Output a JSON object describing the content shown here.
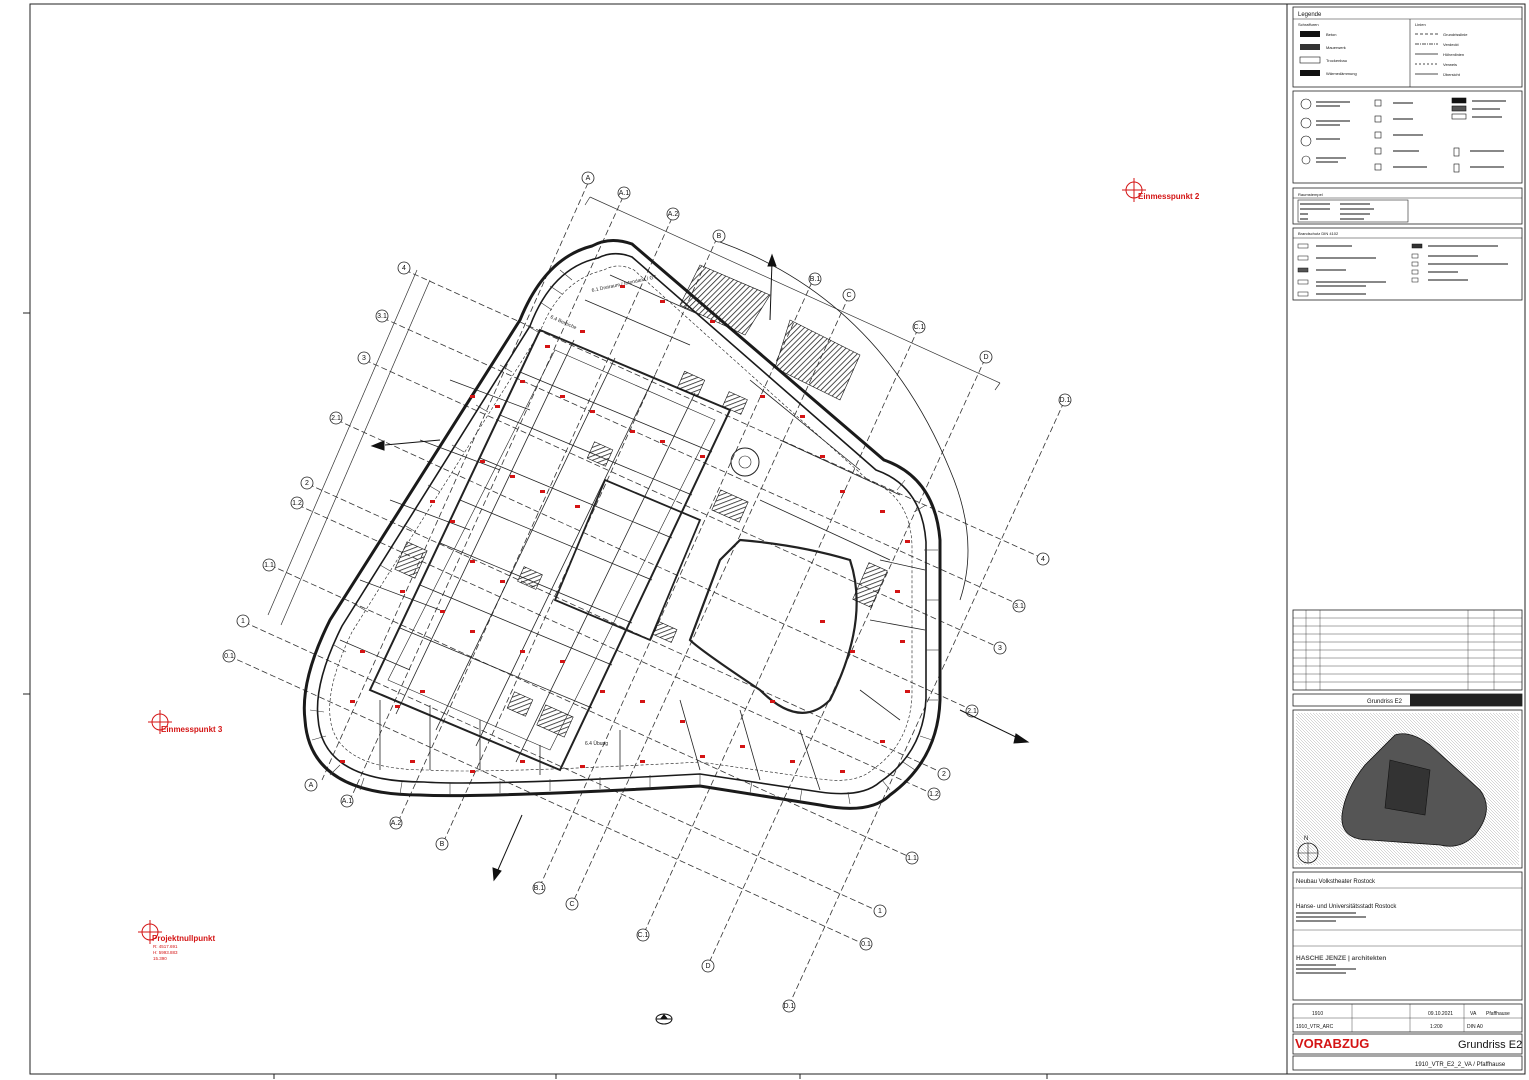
{
  "drawing": {
    "survey_points": [
      {
        "label": "Einmesspunkt 2"
      },
      {
        "label": "Einmesspunkt 3"
      },
      {
        "label": "Projektnullpunkt",
        "coords": [
          "R: 4517.691",
          "H: 5993.883",
          "15.390"
        ]
      }
    ],
    "grid_letters": [
      "A",
      "A.1",
      "A.2",
      "B",
      "B.1",
      "C",
      "C.1",
      "D",
      "D.1"
    ],
    "grid_numbers": [
      "4",
      "3.1",
      "3",
      "2.1",
      "2",
      "1.2",
      "1.1",
      "1",
      "0.1"
    ],
    "room_labels": [
      "6.1 Dreiraum / Intendanz / GT",
      "6.4 Bereiche",
      "6.4 Übung"
    ]
  },
  "title_block": {
    "legend_title": "Legende",
    "hatch_header": "Schraffuren",
    "line_header": "Linien",
    "hatch_items": [
      "Beton",
      "Mauerwerk",
      "Trockenbau",
      "Wärmedämmung"
    ],
    "line_items": [
      "Grundrisslinie",
      "Verdeckt",
      "Höhenlinien",
      "Verweis",
      "Übersicht"
    ],
    "room_stamp_title": "Raumstempel",
    "fire_title": "Brandschutz DIN 4102",
    "drawing_name": "Grundriss E2",
    "project": "Neubau Volkstheater Rostock",
    "client": "Hanse- und Universitätsstadt Rostock",
    "architect": "HASCHE JENZE | architekten",
    "project_no": "1910",
    "date": "09.10.2021",
    "phase": "VA",
    "author": "Pfaffhause",
    "file_code": "1910_VTR_ARC",
    "scale": "1:200",
    "sheet_format": "DIN A0",
    "status": "VORABZUG",
    "sheet_code": "1910_VTR_E2_2_VA / Pfaffhause"
  },
  "colors": {
    "red": "#d41414",
    "line": "#1a1a1a",
    "hatch": "#555555"
  }
}
